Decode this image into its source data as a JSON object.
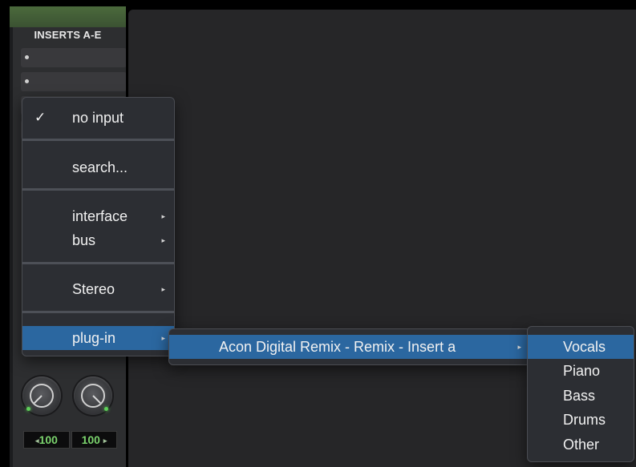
{
  "strip": {
    "inserts_label": "INSERTS A-E",
    "pan_left": "100",
    "pan_right": "100",
    "pan_left_arrow": "◂",
    "pan_right_arrow": "▸"
  },
  "menu": {
    "check_mark": "✓",
    "items": [
      {
        "label": "no input",
        "checked": true
      },
      {
        "label": "search..."
      },
      {
        "label": "interface",
        "submenu": true
      },
      {
        "label": "bus",
        "submenu": true
      },
      {
        "label": "Stereo",
        "submenu": true
      },
      {
        "label": "plug-in",
        "submenu": true,
        "highlighted": true
      }
    ],
    "submenu_arrow": "▸"
  },
  "plugin_submenu": {
    "items": [
      {
        "label": "Acon Digital Remix - Remix - Insert a",
        "submenu": true,
        "highlighted": true
      }
    ]
  },
  "stems_submenu": {
    "items": [
      {
        "label": "Vocals",
        "highlighted": true
      },
      {
        "label": "Piano"
      },
      {
        "label": "Bass"
      },
      {
        "label": "Drums"
      },
      {
        "label": "Other"
      }
    ]
  },
  "colors": {
    "highlight": "#2b67a0",
    "menu_bg": "#2c2e33",
    "pan_value": "#7bd36d"
  }
}
